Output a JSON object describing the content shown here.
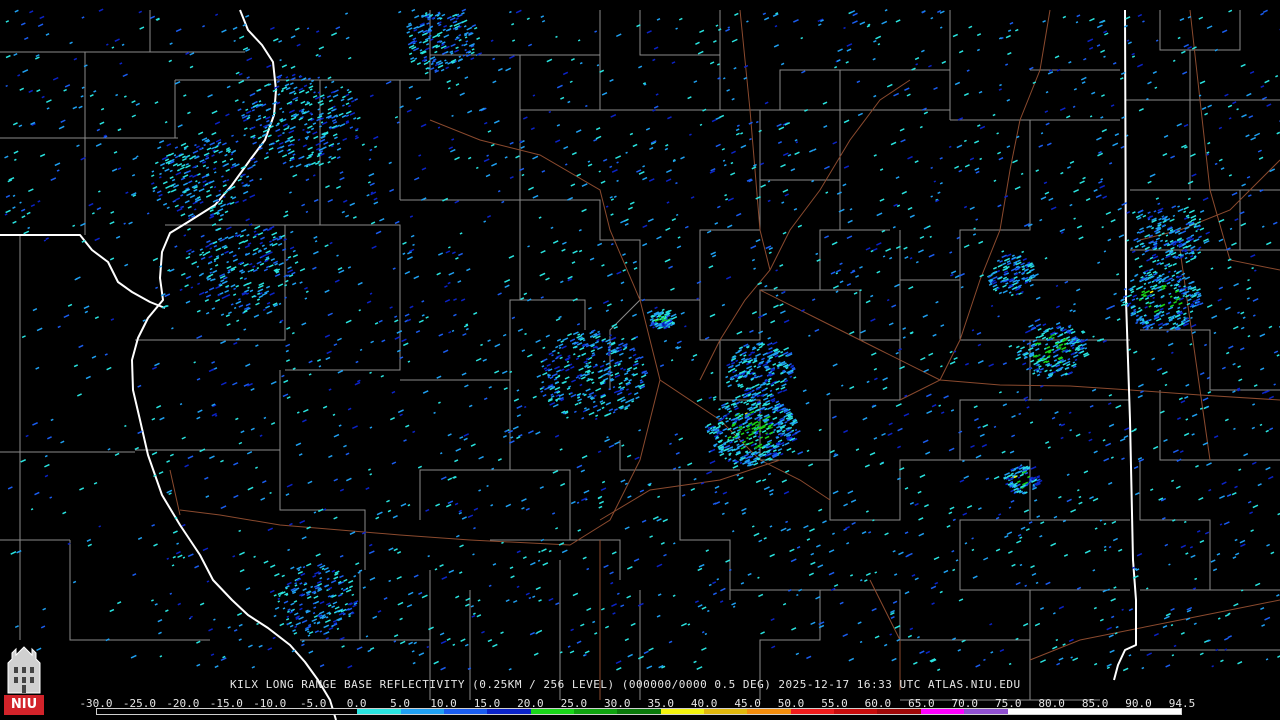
{
  "product_caption": "KILX LONG RANGE BASE REFLECTIVITY (0.25KM / 256 LEVEL) (000000/0000 0.5 DEG) 2025-12-17 16:33 UTC  ATLAS.NIU.EDU",
  "logo_text": "NIU",
  "legend": {
    "labels": [
      "-30.0",
      "-25.0",
      "-20.0",
      "-15.0",
      "-10.0",
      "-5.0",
      "0.0",
      "5.0",
      "10.0",
      "15.0",
      "20.0",
      "25.0",
      "30.0",
      "35.0",
      "40.0",
      "45.0",
      "50.0",
      "55.0",
      "60.0",
      "65.0",
      "70.0",
      "75.0",
      "80.0",
      "85.0",
      "90.0",
      "94.5"
    ],
    "colors": [
      "#000000",
      "#000000",
      "#000000",
      "#000000",
      "#000000",
      "#000000",
      "#29e4e0",
      "#1fa0f2",
      "#1a5df0",
      "#0b23c8",
      "#19d619",
      "#0fa40f",
      "#0a7a0a",
      "#f2f20e",
      "#e0b80c",
      "#f28c0c",
      "#ef1c1c",
      "#c80c0c",
      "#a00808",
      "#ff00ff",
      "#9050d0",
      "#ffffff",
      "#ffffff",
      "#ffffff",
      "#ffffff"
    ]
  },
  "colors": {
    "state_border": "#ffffff",
    "county_border": "#8a8a8a",
    "highway": "#8b4a2e",
    "background": "#000000"
  }
}
